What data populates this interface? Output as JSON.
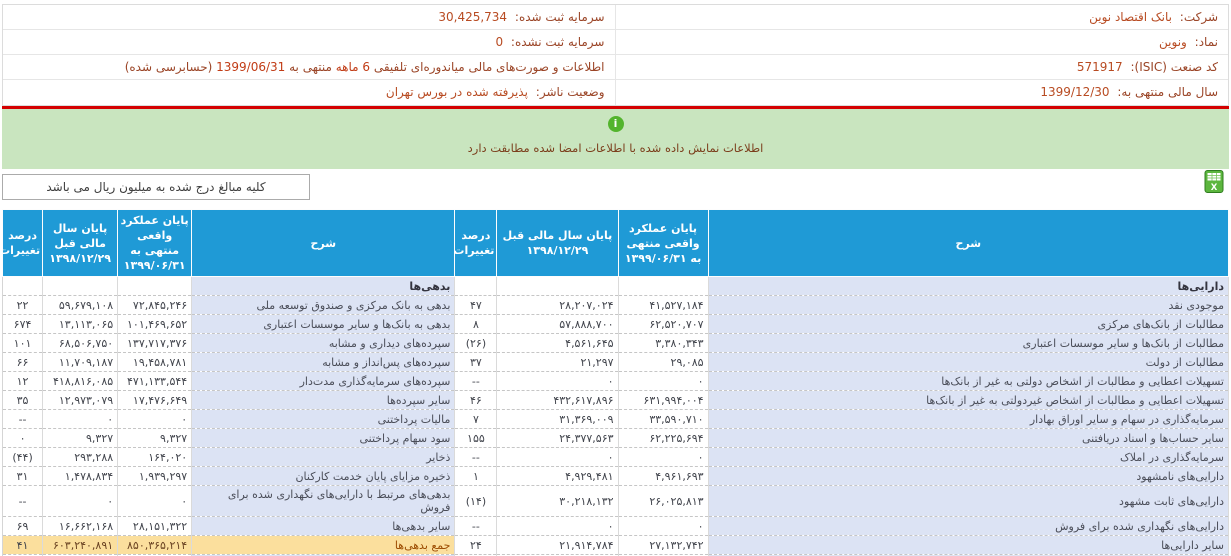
{
  "info": {
    "company": {
      "label": "شرکت:",
      "value": "بانک اقتصاد نوین"
    },
    "symbol": {
      "label": "نماد:",
      "value": "ونوین"
    },
    "isic": {
      "label": "کد صنعت (ISIC):",
      "value": "571917"
    },
    "fiscal_year": {
      "label": "سال مالی منتهی به:",
      "value": "1399/12/30"
    },
    "registered_capital": {
      "label": "سرمایه ثبت شده:",
      "value": "30,425,734"
    },
    "unregistered_capital": {
      "label": "سرمایه ثبت نشده:",
      "value": "0"
    },
    "statement": {
      "parts": [
        {
          "text": "اطلاعات و صورت‌های مالی میاندوره‌ای تلفیقی ",
          "hl": false
        },
        {
          "text": "6 ماهه",
          "hl": true
        },
        {
          "text": " منتهی به ",
          "hl": false
        },
        {
          "text": "1399/06/31",
          "hl": true
        },
        {
          "text": " (حسابرسی شده)",
          "hl": false
        }
      ]
    },
    "publisher_status": {
      "label": "وضعیت ناشر:",
      "value": "پذیرفته شده در بورس تهران"
    }
  },
  "banner": {
    "icon_glyph": "i",
    "message": "اطلاعات نمایش داده شده با اطلاعات امضا شده مطابقت دارد"
  },
  "note": {
    "text": "کلیه مبالغ درج شده به میلیون ریال می باشد"
  },
  "table": {
    "headers": {
      "desc": "شرح",
      "current": "پایان عملکرد واقعی منتهی به ۱۳۹۹/۰۶/۳۱",
      "previous": "پایان سال مالی قبل ۱۳۹۸/۱۲/۲۹",
      "pct": "درصد تغییرات"
    },
    "asset_section": "دارایی‌ها",
    "liability_section": "بدهی‌ها",
    "rows": [
      {
        "asset": {
          "desc": "موجودی نقد",
          "cur": "۴۱,۵۲۷,۱۸۴",
          "prev": "۲۸,۲۰۷,۰۲۴",
          "pct": "۴۷"
        },
        "liab": {
          "desc": "بدهی به بانک مرکزی و صندوق توسعه ملی",
          "cur": "۷۲,۸۴۵,۲۴۶",
          "prev": "۵۹,۶۷۹,۱۰۸",
          "pct": "۲۲"
        }
      },
      {
        "asset": {
          "desc": "مطالبات از بانک‌های مرکزی",
          "cur": "۶۲,۵۲۰,۷۰۷",
          "prev": "۵۷,۸۸۸,۷۰۰",
          "pct": "۸"
        },
        "liab": {
          "desc": "بدهی به بانک‌ها و سایر موسسات اعتباری",
          "cur": "۱۰۱,۴۶۹,۶۵۲",
          "prev": "۱۳,۱۱۳,۰۶۵",
          "pct": "۶۷۴"
        }
      },
      {
        "asset": {
          "desc": "مطالبات از بانک‌ها و سایر موسسات اعتباری",
          "cur": "۳,۳۸۰,۳۴۳",
          "prev": "۴,۵۶۱,۶۴۵",
          "pct": "(۲۶)"
        },
        "liab": {
          "desc": "سپرده‌های دیداری و مشابه",
          "cur": "۱۳۷,۷۱۷,۳۷۶",
          "prev": "۶۸,۵۰۶,۷۵۰",
          "pct": "۱۰۱"
        }
      },
      {
        "asset": {
          "desc": "مطالبات از دولت",
          "cur": "۲۹,۰۸۵",
          "prev": "۲۱,۲۹۷",
          "pct": "۳۷"
        },
        "liab": {
          "desc": "سپرده‌های پس‌انداز و مشابه",
          "cur": "۱۹,۴۵۸,۷۸۱",
          "prev": "۱۱,۷۰۹,۱۸۷",
          "pct": "۶۶"
        }
      },
      {
        "asset": {
          "desc": "تسهیلات اعطایی و مطالبات از اشخاص دولتی به غیر از بانک‌ها",
          "cur": "۰",
          "prev": "۰",
          "pct": "--"
        },
        "liab": {
          "desc": "سپرده‌های سرمایه‌گذاری مدت‌دار",
          "cur": "۴۷۱,۱۳۳,۵۴۴",
          "prev": "۴۱۸,۸۱۶,۰۸۵",
          "pct": "۱۲"
        }
      },
      {
        "asset": {
          "desc": "تسهیلات اعطایی و مطالبات از اشخاص غیردولتی به غیر از بانک‌ها",
          "cur": "۶۳۱,۹۹۴,۰۰۴",
          "prev": "۴۳۲,۶۱۷,۸۹۶",
          "pct": "۴۶"
        },
        "liab": {
          "desc": "سایر سپرده‌ها",
          "cur": "۱۷,۴۷۶,۶۴۹",
          "prev": "۱۲,۹۷۳,۰۷۹",
          "pct": "۳۵"
        }
      },
      {
        "asset": {
          "desc": "سرمایه‌گذاری در سهام و سایر اوراق بهادار",
          "cur": "۳۳,۵۹۰,۷۱۰",
          "prev": "۳۱,۳۶۹,۰۰۹",
          "pct": "۷"
        },
        "liab": {
          "desc": "مالیات پرداختنی",
          "cur": "۰",
          "prev": "۰",
          "pct": "--"
        }
      },
      {
        "asset": {
          "desc": "سایر حساب‌ها و اسناد دریافتنی",
          "cur": "۶۲,۲۲۵,۶۹۴",
          "prev": "۲۴,۳۷۷,۵۶۳",
          "pct": "۱۵۵"
        },
        "liab": {
          "desc": "سود سهام پرداختنی",
          "cur": "۹,۳۲۷",
          "prev": "۹,۳۲۷",
          "pct": "۰"
        }
      },
      {
        "asset": {
          "desc": "سرمایه‌گذاری در املاک",
          "cur": "۰",
          "prev": "۰",
          "pct": "--"
        },
        "liab": {
          "desc": "ذخایر",
          "cur": "۱۶۴,۰۲۰",
          "prev": "۲۹۳,۲۸۸",
          "pct": "(۴۴)"
        }
      },
      {
        "asset": {
          "desc": "دارایی‌های نامشهود",
          "cur": "۴,۹۶۱,۶۹۳",
          "prev": "۴,۹۲۹,۴۸۱",
          "pct": "۱"
        },
        "liab": {
          "desc": "ذخیره مزایای پایان خدمت کارکنان",
          "cur": "۱,۹۳۹,۲۹۷",
          "prev": "۱,۴۷۸,۸۳۴",
          "pct": "۳۱"
        }
      },
      {
        "asset": {
          "desc": "دارایی‌های ثابت مشهود",
          "cur": "۲۶,۰۲۵,۸۱۳",
          "prev": "۳۰,۲۱۸,۱۳۲",
          "pct": "(۱۴)"
        },
        "liab": {
          "desc": "بدهی‌های مرتبط با دارایی‌های نگهداری شده برای فروش",
          "cur": "۰",
          "prev": "۰",
          "pct": "--"
        }
      },
      {
        "asset": {
          "desc": "دارایی‌های نگهداری شده برای فروش",
          "cur": "۰",
          "prev": "۰",
          "pct": "--"
        },
        "liab": {
          "desc": "سایر بدهی‌ها",
          "cur": "۲۸,۱۵۱,۳۲۲",
          "prev": "۱۶,۶۶۲,۱۶۸",
          "pct": "۶۹"
        }
      },
      {
        "total": true,
        "asset": {
          "desc": "سایر دارایی‌ها",
          "cur": "۲۷,۱۳۲,۷۴۲",
          "prev": "۲۱,۹۱۴,۷۸۴",
          "pct": "۲۴"
        },
        "liab": {
          "desc": "جمع بدهی‌ها",
          "cur": "۸۵۰,۳۶۵,۲۱۴",
          "prev": "۶۰۳,۲۴۰,۸۹۱",
          "pct": "۴۱"
        }
      }
    ],
    "colors": {
      "header_bg": "#1f9ad6",
      "desc_bg": "#dce3f4",
      "total_bg": "#fbdf9d",
      "positive": "#0d8a0d",
      "negative": "#e80000",
      "banner_bg": "#c9e5bf",
      "divider_red": "#d40000"
    }
  }
}
